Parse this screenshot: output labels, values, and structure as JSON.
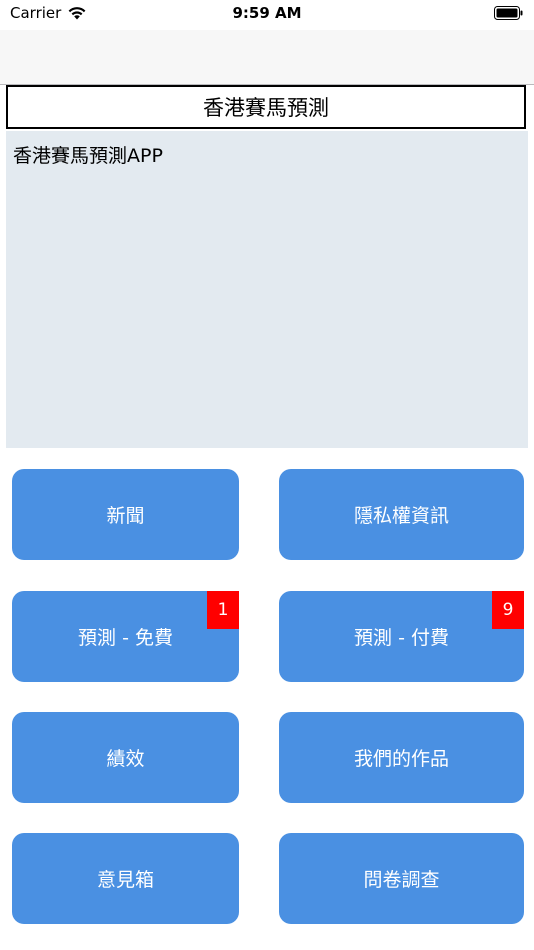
{
  "status_bar": {
    "carrier": "Carrier",
    "time": "9:59 AM",
    "wifi_icon": "wifi-icon",
    "battery_icon": "battery-icon"
  },
  "header": {
    "title": "香港賽馬預測"
  },
  "content": {
    "text": "香港賽馬預測APP"
  },
  "buttons": [
    {
      "label": "新聞"
    },
    {
      "label": "隱私權資訊"
    },
    {
      "label": "預測 - 免費",
      "badge": "1"
    },
    {
      "label": "預測 - 付費",
      "badge": "9"
    },
    {
      "label": "績效"
    },
    {
      "label": "我們的作品"
    },
    {
      "label": "意見箱"
    },
    {
      "label": "問卷調查"
    }
  ],
  "colors": {
    "button_bg": "#4a90e2",
    "badge_bg": "#ff0000",
    "content_bg": "#e3eaf0"
  }
}
